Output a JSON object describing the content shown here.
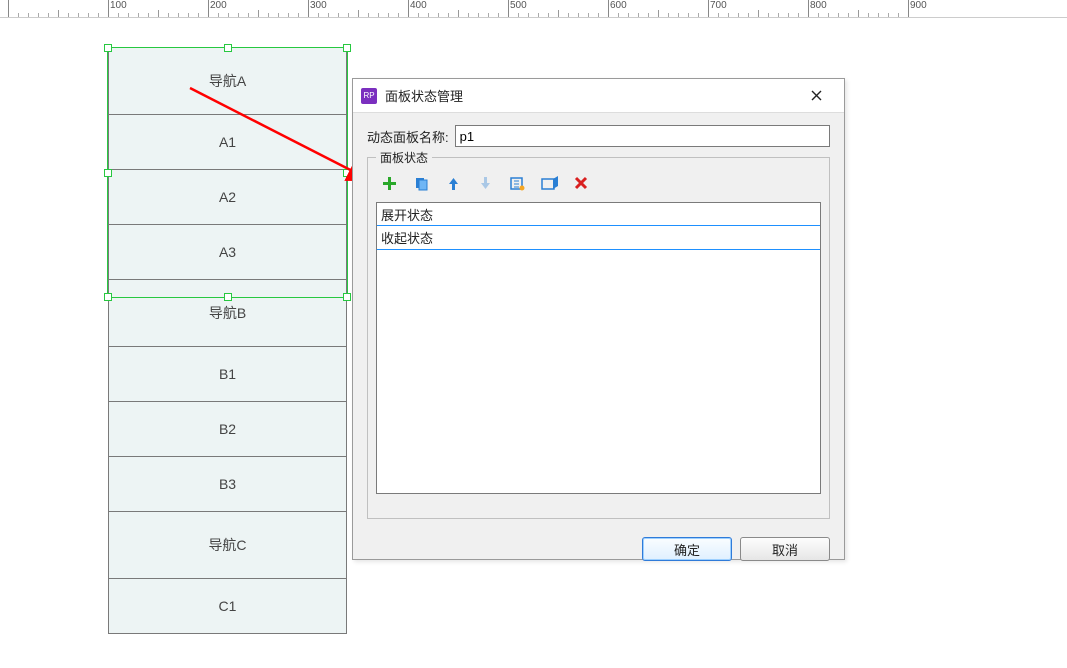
{
  "ruler": {
    "max": 900,
    "major_step": 100,
    "minor_step": 10
  },
  "canvas": {
    "cells": [
      {
        "label": "导航A",
        "type": "header"
      },
      {
        "label": "A1",
        "type": "item"
      },
      {
        "label": "A2",
        "type": "item"
      },
      {
        "label": "A3",
        "type": "item"
      },
      {
        "label": "导航B",
        "type": "header"
      },
      {
        "label": "B1",
        "type": "item"
      },
      {
        "label": "B2",
        "type": "item"
      },
      {
        "label": "B3",
        "type": "item"
      },
      {
        "label": "导航C",
        "type": "header"
      },
      {
        "label": "C1",
        "type": "item"
      }
    ]
  },
  "dialog": {
    "title": "面板状态管理",
    "name_label": "动态面板名称:",
    "name_value": "p1",
    "group_label": "面板状态",
    "toolbar": {
      "add": "add-icon",
      "duplicate": "duplicate-icon",
      "up": "arrow-up-icon",
      "down": "arrow-down-icon",
      "edit": "edit-states-icon",
      "open": "open-icon",
      "delete": "delete-icon"
    },
    "states": [
      "展开状态",
      "收起状态"
    ],
    "editing_index": 1,
    "ok_label": "确定",
    "cancel_label": "取消"
  }
}
